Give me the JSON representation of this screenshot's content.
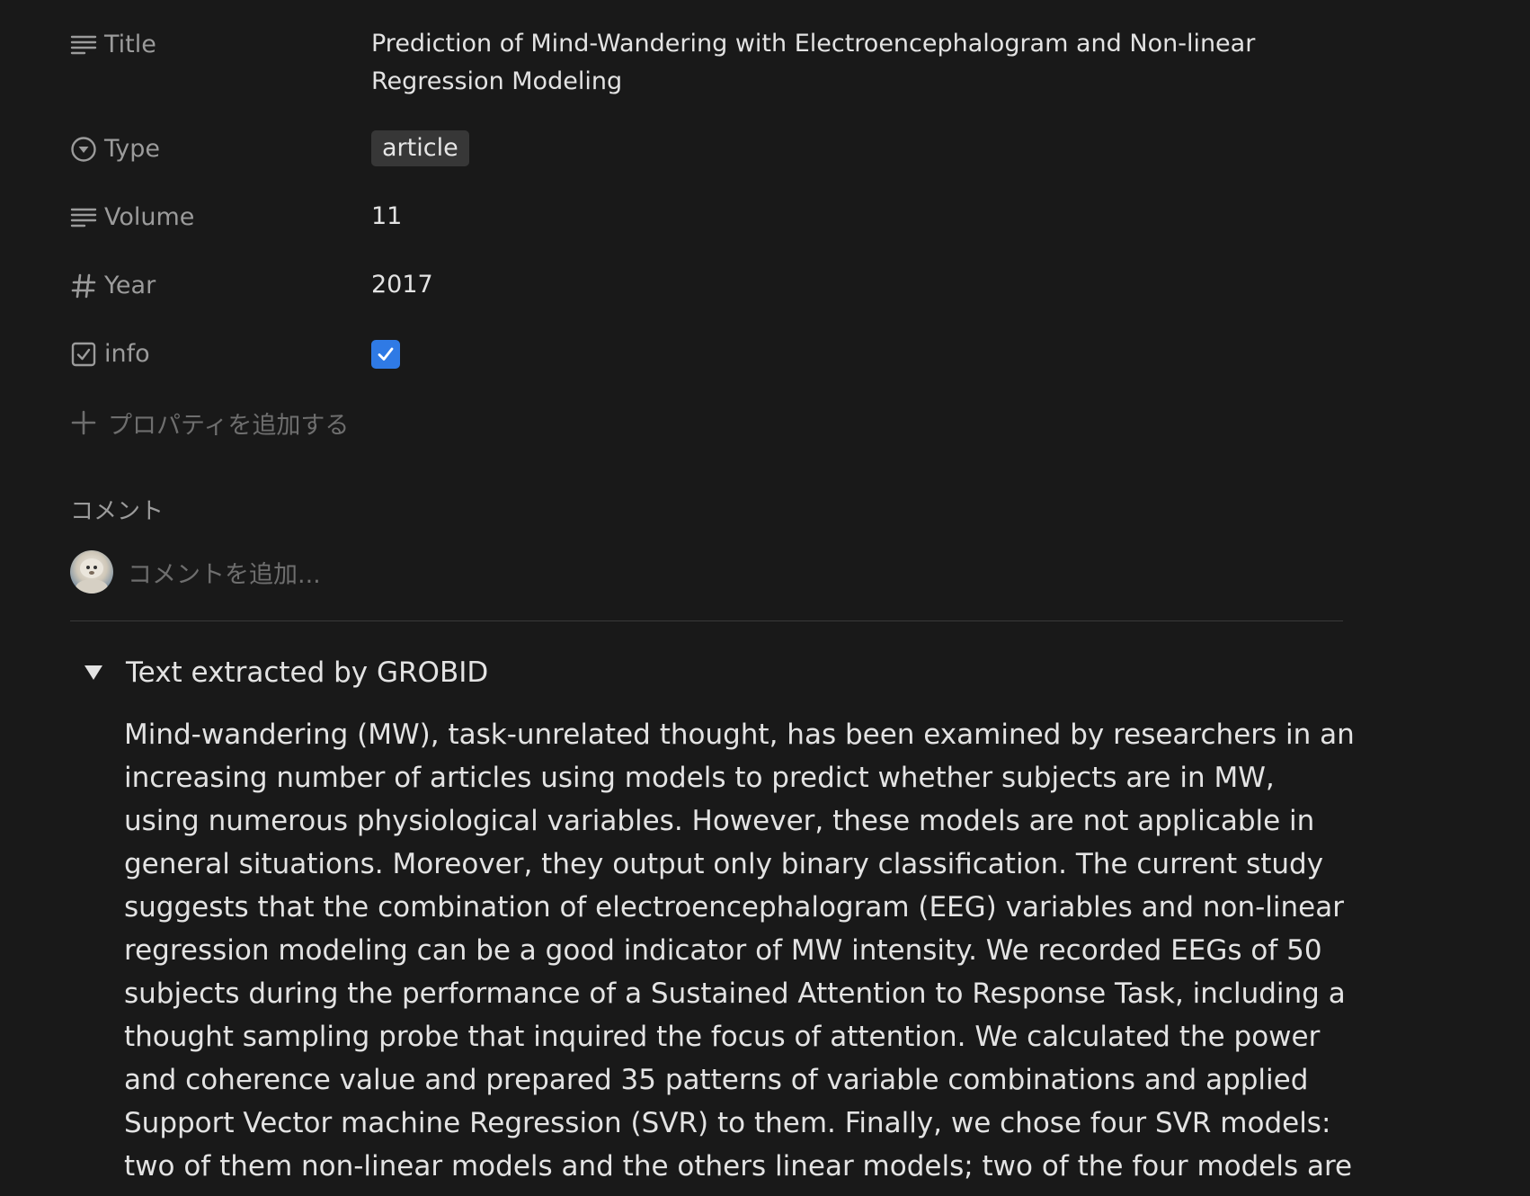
{
  "properties": {
    "title": {
      "label": "Title",
      "value": "Prediction of Mind-Wandering with Electroencephalogram and Non-linear Regression Modeling",
      "icon": "text-lines-icon"
    },
    "type": {
      "label": "Type",
      "value": "article",
      "icon": "select-circle-icon"
    },
    "volume": {
      "label": "Volume",
      "value": "11",
      "icon": "text-lines-icon"
    },
    "year": {
      "label": "Year",
      "value": "2017",
      "icon": "hash-icon"
    },
    "info": {
      "label": "info",
      "checked": true,
      "icon": "checkbox-icon"
    }
  },
  "add_property_label": "プロパティを追加する",
  "comments": {
    "heading": "コメント",
    "placeholder": "コメントを追加..."
  },
  "toggle": {
    "title": "Text extracted by GROBID",
    "expanded": true,
    "body": "Mind-wandering (MW), task-unrelated thought, has been examined by researchers in an increasing number of articles using models to predict whether subjects are in MW, using numerous physiological variables. However, these models are not applicable in general situations. Moreover, they output only binary classification. The current study suggests that the combination of electroencephalogram (EEG) variables and non-linear regression modeling can be a good indicator of MW intensity. We recorded EEGs of 50 subjects during the performance of a Sustained Attention to Response Task, including a thought sampling probe that inquired the focus of attention. We calculated the power and coherence value and prepared 35 patterns of variable combinations and applied Support Vector machine Regression (SVR) to them. Finally, we chose four SVR models: two of them non-linear models and the others linear models; two of the four models are composed of a limited number of"
  },
  "colors": {
    "background": "#191919",
    "checkbox": "#2f7ae5",
    "tag_bg": "#373737"
  }
}
